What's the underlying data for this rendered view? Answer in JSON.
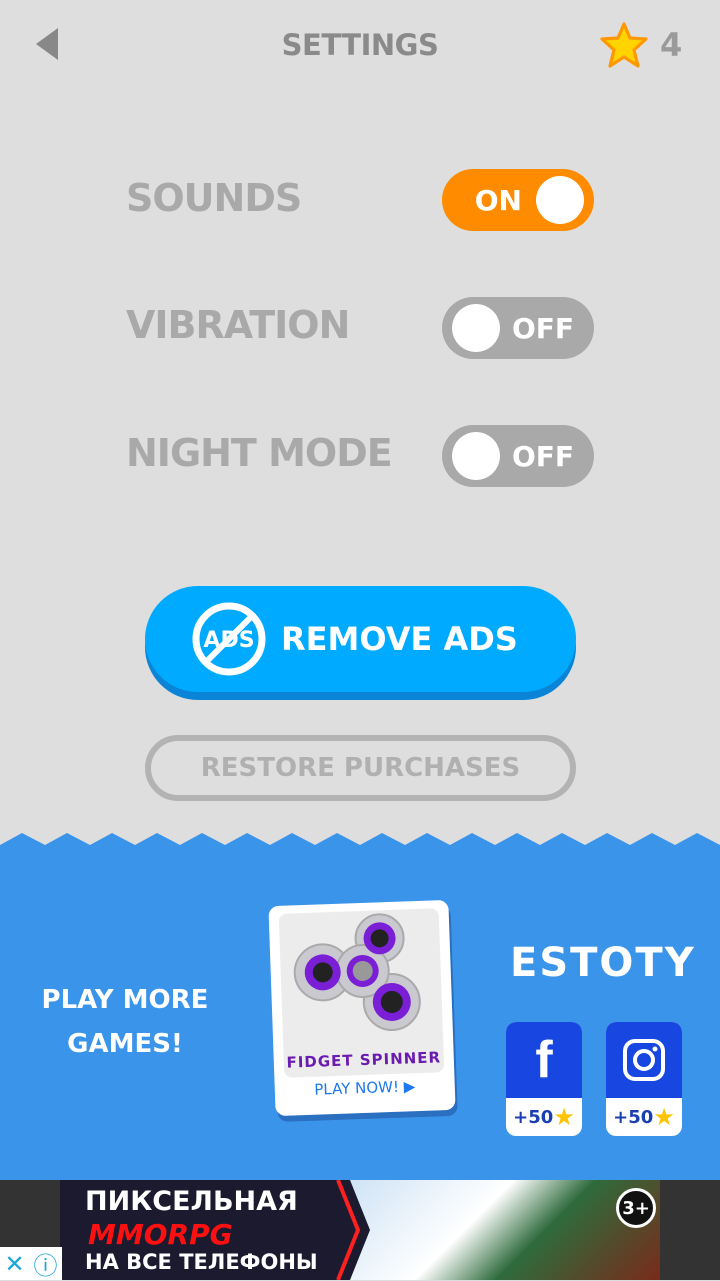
{
  "header": {
    "title": "SETTINGS",
    "star_count": "4",
    "back_icon": "back-arrow-icon",
    "star_icon": "star-icon"
  },
  "settings": [
    {
      "label": "SOUNDS",
      "state": "ON",
      "on": true
    },
    {
      "label": "VIBRATION",
      "state": "OFF",
      "on": false
    },
    {
      "label": "NIGHT MODE",
      "state": "OFF",
      "on": false
    }
  ],
  "remove_ads": {
    "label": "REMOVE ADS",
    "icon_text": "ADS"
  },
  "restore_label": "RESTORE PURCHASES",
  "more_games": {
    "label_1": "PLAY MORE",
    "label_2": "GAMES!",
    "card_title": "FIDGET  SPINNER",
    "card_action": "PLAY NOW!"
  },
  "brand": "ESTOTY",
  "social": [
    {
      "name": "facebook",
      "reward": "+50"
    },
    {
      "name": "instagram",
      "reward": "+50"
    }
  ],
  "ad": {
    "line1": "ПИКСЕЛЬНАЯ",
    "line2": "MMORPG",
    "line3": "НА ВСЕ ТЕЛЕФОНЫ",
    "age": "3+"
  },
  "colors": {
    "accent_on": "#ff8c00",
    "toggle_off": "#a9a9a9",
    "remove_ads": "#00aaff",
    "panel": "#3a94ea",
    "social": "#1846e0"
  }
}
